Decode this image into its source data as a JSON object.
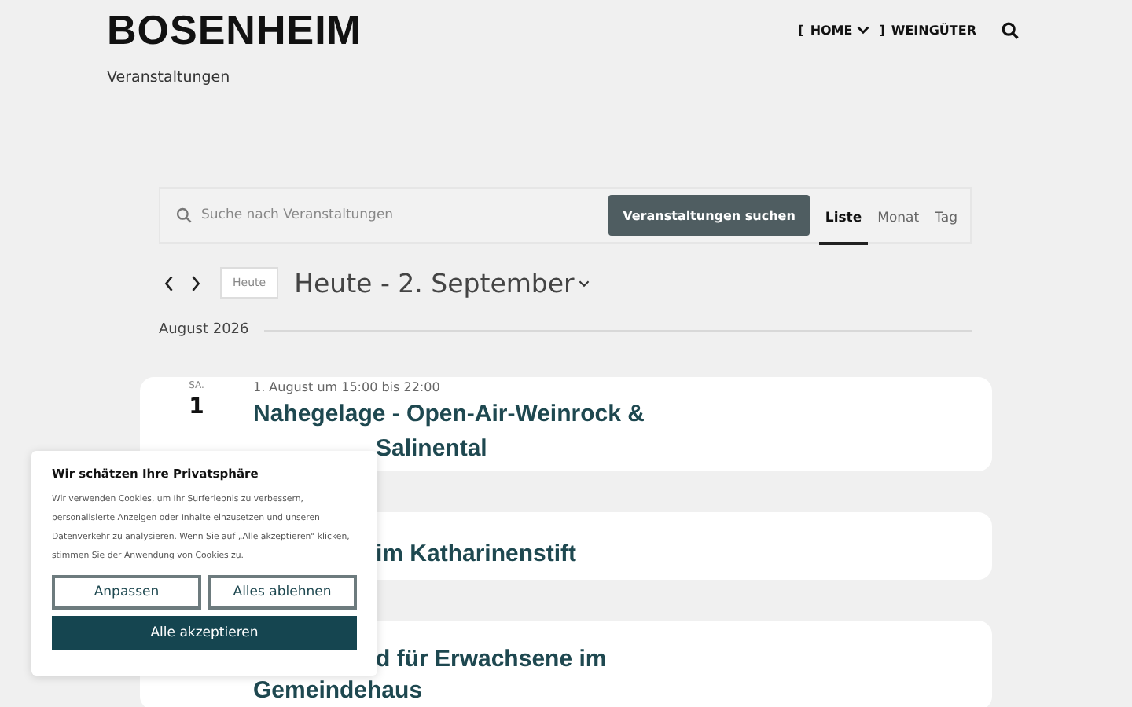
{
  "header": {
    "logo": "BOSENHEIM",
    "subtitle": "Veranstaltungen",
    "nav": [
      {
        "label": "HOME",
        "dropdown": true,
        "open_bracket": "[",
        "close_bracket": "]"
      },
      {
        "label": "WEINGÜTER",
        "dropdown": false
      }
    ]
  },
  "search": {
    "placeholder": "Suche nach Veranstaltungen",
    "button": "Veranstaltungen suchen"
  },
  "views": [
    {
      "label": "Liste",
      "selected": true
    },
    {
      "label": "Monat",
      "selected": false
    },
    {
      "label": "Tag",
      "selected": false
    }
  ],
  "date_nav": {
    "today_button": "Heute",
    "range": "Heute - 2. September"
  },
  "month_label": "August 2026",
  "events": [
    {
      "weekday": "SA.",
      "day": "1",
      "time": "1. August um 15:00 bis 22:00",
      "title_lines": [
        "Nahegelage - Open-Air-Weinrock &",
        "Salinental"
      ]
    },
    {
      "title_lines": [
        "im Katharinenstift"
      ]
    },
    {
      "title_lines": [
        "d für Erwachsene im",
        "Gemeindehaus"
      ]
    }
  ],
  "cookie_banner": {
    "title": "Wir schätzen Ihre Privatsphäre",
    "text": "Wir verwenden Cookies, um Ihr Surferlebnis zu verbessern, personalisierte Anzeigen oder Inhalte einzusetzen und unseren Datenverkehr zu analysieren. Wenn Sie auf „Alle akzeptieren\" klicken, stimmen Sie der Anwendung von Cookies zu.",
    "buttons": [
      {
        "label": "Anpassen",
        "kind": "outline"
      },
      {
        "label": "Alles ablehnen",
        "kind": "outline"
      },
      {
        "label": "Alle akzeptieren",
        "kind": "primary"
      }
    ]
  }
}
